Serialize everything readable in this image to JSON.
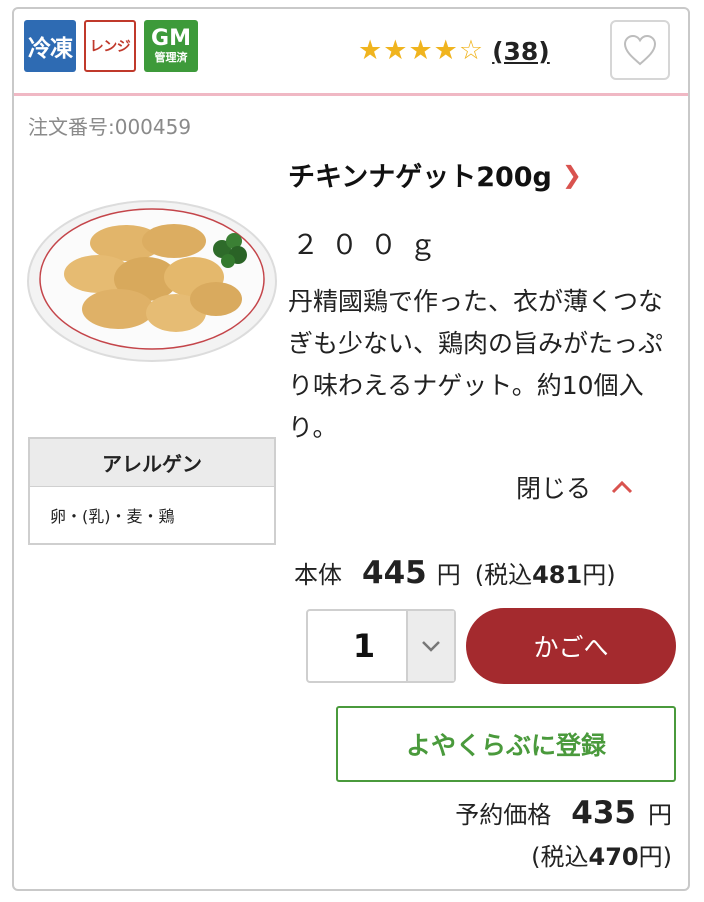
{
  "badges": {
    "frozen": "冷凍",
    "microwave": "レンジ",
    "gm_top": "GM",
    "gm_bottom": "管理済"
  },
  "rating": {
    "stars_filled": 4,
    "stars_total": 5,
    "review_count": "(38)"
  },
  "favorite": {
    "icon": "heart-outline-icon"
  },
  "order_number": "注文番号:000459",
  "product": {
    "image_icon": "chicken-nugget-plate",
    "name": "チキンナゲット200g",
    "weight": "２００ｇ",
    "description": "丹精國鶏で作った、衣が薄くつなぎも少ない、鶏肉の旨みがたっぷり味わえるナゲット。約10個入り。",
    "close_label": "閉じる"
  },
  "allergen": {
    "title": "アレルゲン",
    "items": "卵・(乳)・麦・鶏"
  },
  "price": {
    "label": "本体",
    "value": "445",
    "yen": "円",
    "tax_prefix": "(税込",
    "tax_value": "481",
    "tax_suffix": "円)"
  },
  "quantity": {
    "value": "1"
  },
  "cart_button": "かごへ",
  "reserve_button": "よやくらぶに登録",
  "reserve_price": {
    "label": "予約価格",
    "value": "435",
    "yen": "円",
    "tax_prefix": "(税込",
    "tax_value": "470",
    "tax_suffix": "円)"
  },
  "colors": {
    "accent_red": "#a42a2e",
    "green": "#4a9a3c",
    "star": "#f0b41e",
    "divider_pink": "#f0b8c4"
  }
}
